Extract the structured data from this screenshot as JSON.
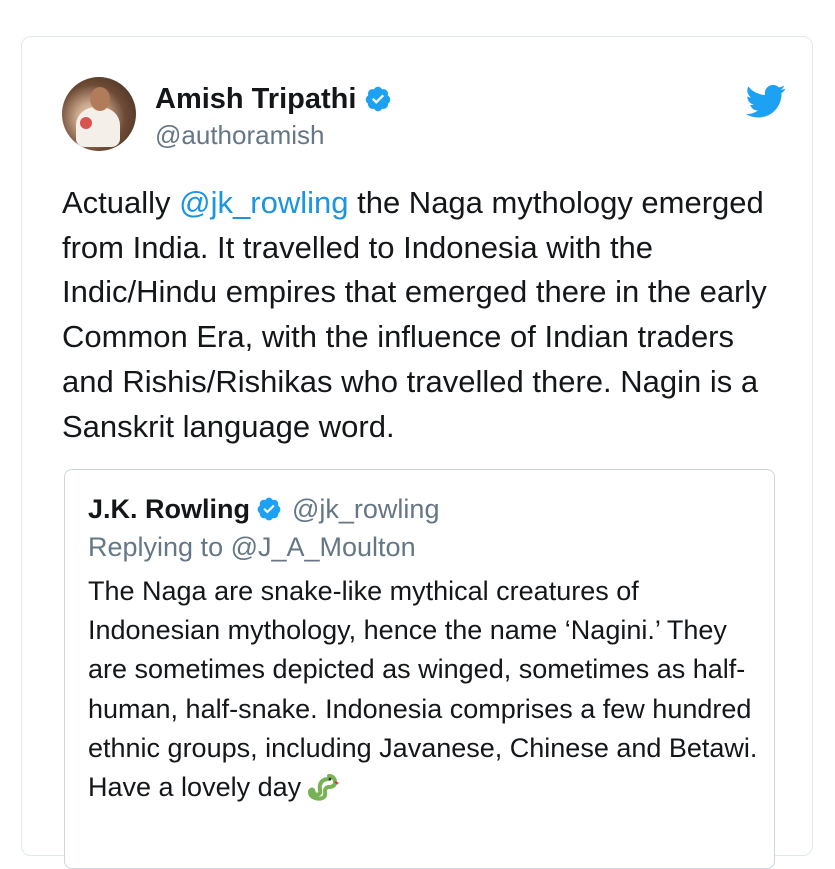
{
  "tweet": {
    "author": {
      "display_name": "Amish Tripathi",
      "handle": "@authoramish",
      "verified": true
    },
    "text_parts": {
      "lead": "Actually ",
      "mention": "@jk_rowling",
      "rest": " the Naga mythology emerged from India. It travelled to Indonesia with the Indic/Hindu empires that emerged there in the early Common Era, with the influence of Indian traders and Rishis/Rishikas who travelled there. Nagin is a Sanskrit language word."
    },
    "icons": {
      "avatar": "avatar-photo",
      "verified": "verified-badge-icon",
      "brand": "twitter-bird-icon"
    }
  },
  "quoted_tweet": {
    "author": {
      "display_name": "J.K. Rowling",
      "handle": "@jk_rowling",
      "verified": true
    },
    "reply_context": "Replying to @J_A_Moulton",
    "text": "The Naga are snake-like mythical creatures of Indonesian mythology, hence the name ‘Nagini.’ They are sometimes depicted as winged, sometimes as half-human, half-snake. Indonesia comprises a few hundred ethnic groups, including Javanese, Chinese and Betawi. Have a lovely day",
    "trailing_emoji": "snake-emoji-icon"
  },
  "colors": {
    "text": "#14171a",
    "secondary": "#657786",
    "accent": "#1b95e0",
    "verified": "#1da1f2",
    "border": "#e1e8ed",
    "snake": "#77b255"
  }
}
